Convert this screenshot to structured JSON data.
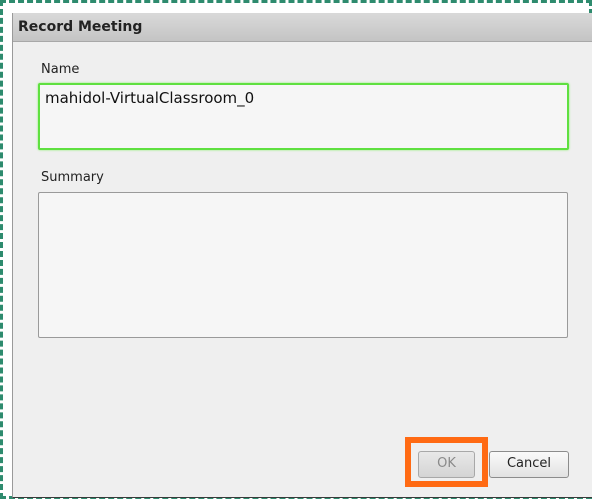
{
  "dialog": {
    "title": "Record Meeting",
    "name_label": "Name",
    "name_value": "mahidol-VirtualClassroom_0",
    "summary_label": "Summary",
    "summary_value": "",
    "ok_label": "OK",
    "cancel_label": "Cancel"
  },
  "colors": {
    "name_focus_border": "#5fe040",
    "highlight_border": "#ff6a13",
    "outer_dashed_border": "#2e8b6e"
  }
}
